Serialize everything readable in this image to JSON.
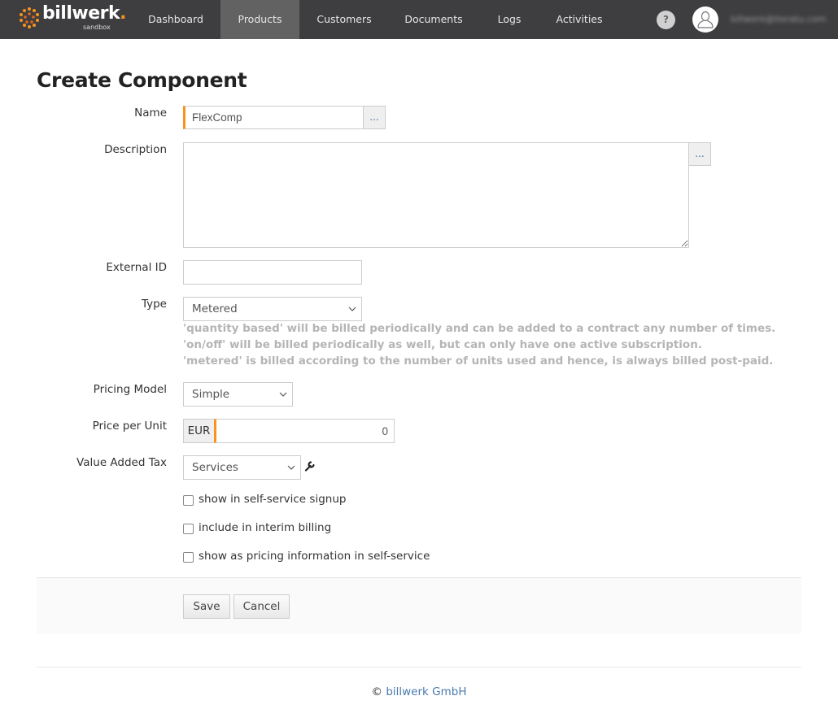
{
  "app": {
    "brand": "billwerk",
    "brand_suffix": ".",
    "environment": "sandbox"
  },
  "nav": {
    "items": [
      {
        "label": "Dashboard",
        "active": false
      },
      {
        "label": "Products",
        "active": true
      },
      {
        "label": "Customers",
        "active": false
      },
      {
        "label": "Documents",
        "active": false
      },
      {
        "label": "Logs",
        "active": false
      },
      {
        "label": "Activities",
        "active": false
      }
    ],
    "help_label": "?",
    "user_email": "billwerk@iteratu.com"
  },
  "page": {
    "title": "Create Component"
  },
  "form": {
    "name": {
      "label": "Name",
      "value": "FlexComp",
      "button": "..."
    },
    "description": {
      "label": "Description",
      "value": "",
      "button": "..."
    },
    "external_id": {
      "label": "External ID",
      "value": ""
    },
    "type": {
      "label": "Type",
      "selected": "Metered",
      "hints": [
        "'quantity based' will be billed periodically and can be added to a contract any number of times.",
        "'on/off' will be billed periodically as well, but can only have one active subscription.",
        "'metered' is billed according to the number of units used and hence, is always billed post-paid."
      ]
    },
    "pricing_model": {
      "label": "Pricing Model",
      "selected": "Simple"
    },
    "price_per_unit": {
      "label": "Price per Unit",
      "currency": "EUR",
      "value": "0"
    },
    "vat": {
      "label": "Value Added Tax",
      "selected": "Services",
      "icon": "wrench-icon"
    },
    "checkboxes": [
      {
        "label": "show in self-service signup",
        "checked": false
      },
      {
        "label": "include in interim billing",
        "checked": false
      },
      {
        "label": "show as pricing information in self-service",
        "checked": false
      }
    ],
    "actions": {
      "save": "Save",
      "cancel": "Cancel"
    }
  },
  "footer": {
    "copyright": "©",
    "company": "billwerk GmbH"
  },
  "colors": {
    "accent": "#f7941d",
    "topbar": "#3e3e40",
    "active_nav": "#626262",
    "link": "#4a7ab0",
    "hint": "#b5b5b5"
  }
}
